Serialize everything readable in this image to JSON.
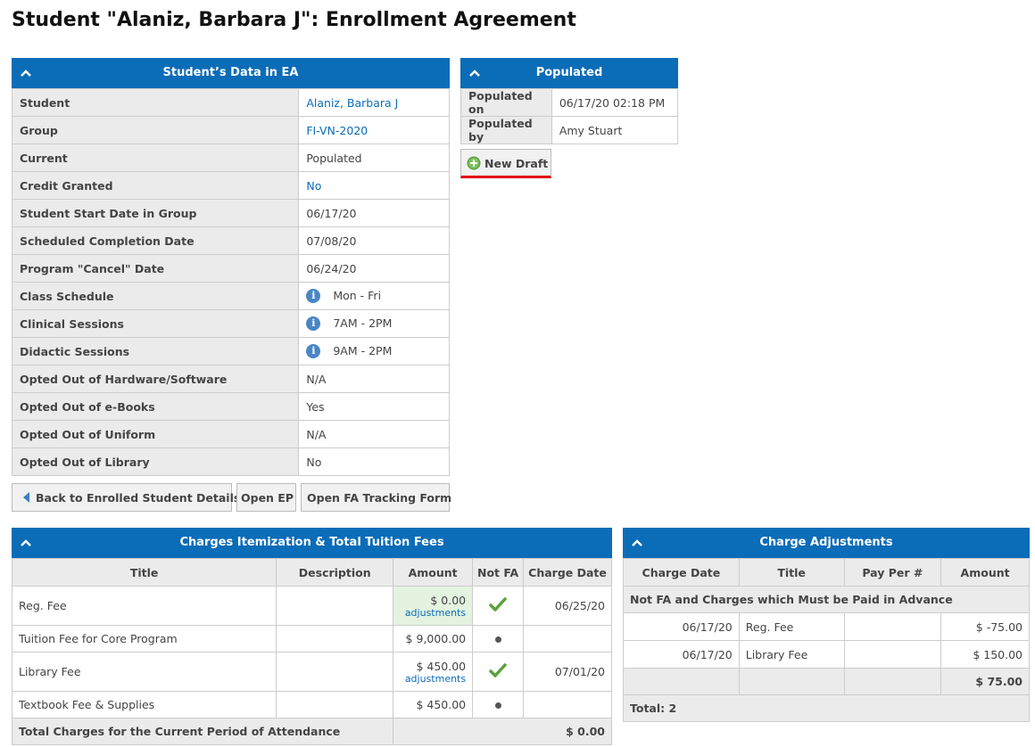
{
  "page": {
    "title": "Student \"Alaniz, Barbara J\": Enrollment Agreement"
  },
  "student_panel": {
    "title": "Student’s Data in EA",
    "rows": [
      {
        "label": "Student",
        "value": "Alaniz, Barbara J",
        "link": true,
        "info": false
      },
      {
        "label": "Group",
        "value": "FI-VN-2020",
        "link": true,
        "info": false
      },
      {
        "label": "Current",
        "value": "Populated",
        "link": false,
        "info": false
      },
      {
        "label": "Credit Granted",
        "value": "No",
        "link": true,
        "info": false
      },
      {
        "label": "Student Start Date in Group",
        "value": "06/17/20",
        "link": false,
        "info": false
      },
      {
        "label": "Scheduled Completion Date",
        "value": "07/08/20",
        "link": false,
        "info": false
      },
      {
        "label": "Program \"Cancel\" Date",
        "value": "06/24/20",
        "link": false,
        "info": false
      },
      {
        "label": "Class Schedule",
        "value": "Mon - Fri",
        "link": false,
        "info": true
      },
      {
        "label": "Clinical Sessions",
        "value": "7AM - 2PM",
        "link": false,
        "info": true
      },
      {
        "label": "Didactic Sessions",
        "value": "9AM - 2PM",
        "link": false,
        "info": true
      },
      {
        "label": "Opted Out of Hardware/Software",
        "value": "N/A",
        "link": false,
        "info": false
      },
      {
        "label": "Opted Out of e-Books",
        "value": "Yes",
        "link": false,
        "info": false
      },
      {
        "label": "Opted Out of Uniform",
        "value": "N/A",
        "link": false,
        "info": false
      },
      {
        "label": "Opted Out of Library",
        "value": "No",
        "link": false,
        "info": false
      }
    ]
  },
  "buttons": {
    "back": "Back to Enrolled Student Details",
    "open_ep": "Open EP",
    "open_fa": "Open FA Tracking Form",
    "new_draft": "New Draft"
  },
  "populated_panel": {
    "title": "Populated",
    "rows": [
      {
        "label": "Populated on",
        "value": "06/17/20 02:18 PM"
      },
      {
        "label": "Populated by",
        "value": "Amy Stuart"
      }
    ]
  },
  "charges_panel": {
    "title": "Charges Itemization & Total Tuition Fees",
    "columns": [
      "Title",
      "Description",
      "Amount",
      "Not FA",
      "Charge Date"
    ],
    "rows": [
      {
        "title": "Reg. Fee",
        "description": "",
        "amount": "$ 0.00",
        "adjustments": "adjustments",
        "not_fa": "check",
        "charge_date": "06/25/20",
        "highlight": true
      },
      {
        "title": "Tuition Fee for Core Program",
        "description": "",
        "amount": "$ 9,000.00",
        "adjustments": "",
        "not_fa": "dot",
        "charge_date": "",
        "highlight": false
      },
      {
        "title": "Library Fee",
        "description": "",
        "amount": "$ 450.00",
        "adjustments": "adjustments",
        "not_fa": "check",
        "charge_date": "07/01/20",
        "highlight": false
      },
      {
        "title": "Textbook Fee & Supplies",
        "description": "",
        "amount": "$ 450.00",
        "adjustments": "",
        "not_fa": "dot",
        "charge_date": "",
        "highlight": false
      }
    ],
    "total_label": "Total Charges for the Current Period of Attendance",
    "total_value": "$ 0.00"
  },
  "adjustments_panel": {
    "title": "Charge Adjustments",
    "columns": [
      "Charge Date",
      "Title",
      "Pay Per #",
      "Amount"
    ],
    "group_label": "Not FA and Charges which Must be Paid in Advance",
    "rows": [
      {
        "charge_date": "06/17/20",
        "title": "Reg. Fee",
        "pay_per": "",
        "amount": "$ -75.00"
      },
      {
        "charge_date": "06/17/20",
        "title": "Library Fee",
        "pay_per": "",
        "amount": "$ 150.00"
      }
    ],
    "subtotal": "$ 75.00",
    "total_label": "Total: 2"
  },
  "colors": {
    "header_blue": "#0b6cb8",
    "link_blue": "#0b6cb8",
    "highlight_red": "#e00000",
    "check_green": "#5aa33c"
  }
}
